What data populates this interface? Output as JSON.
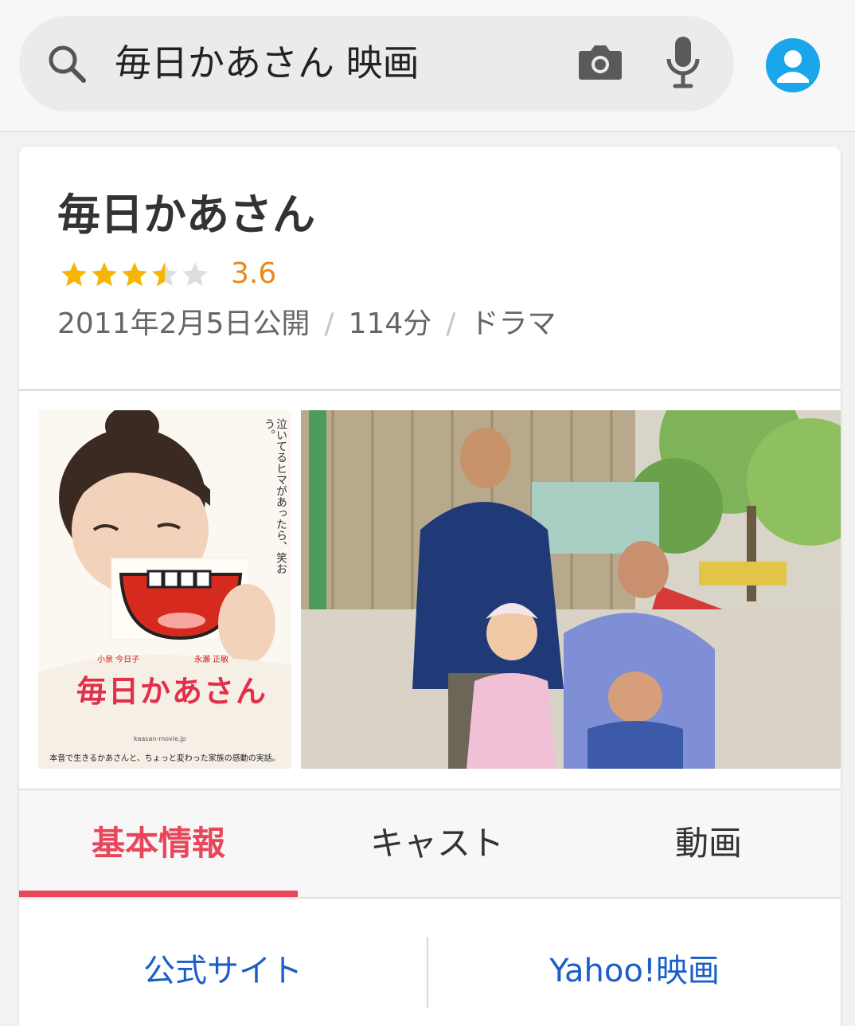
{
  "search": {
    "query": "毎日かあさん 映画",
    "icons": [
      "search-icon",
      "camera-icon",
      "microphone-icon",
      "account-icon"
    ]
  },
  "movie": {
    "title": "毎日かあさん",
    "rating_value": "3.6",
    "rating_stars": 3.5,
    "release": "2011年2月5日公開",
    "runtime": "114分",
    "genre": "ドラマ",
    "separator": "/"
  },
  "poster": {
    "side_text": "泣いてるヒマがあったら、笑おう。",
    "cast_left": "小泉 今日子",
    "cast_right": "永瀬 正敏",
    "title": "毎日かあさん",
    "tagline": "本音で生きるかあさんと、ちょっと変わった家族の感動の実話。",
    "url": "kaasan-movie.jp"
  },
  "tabs": [
    {
      "label": "基本情報",
      "active": true
    },
    {
      "label": "キャスト",
      "active": false
    },
    {
      "label": "動画",
      "active": false
    }
  ],
  "links": {
    "official": "公式サイト",
    "yahoo": "Yahoo!映画"
  },
  "colors": {
    "accent": "#e8465a",
    "rating": "#e8891c",
    "star": "#f5b500",
    "link": "#1a5fc8",
    "avatar": "#1aa6ea"
  }
}
